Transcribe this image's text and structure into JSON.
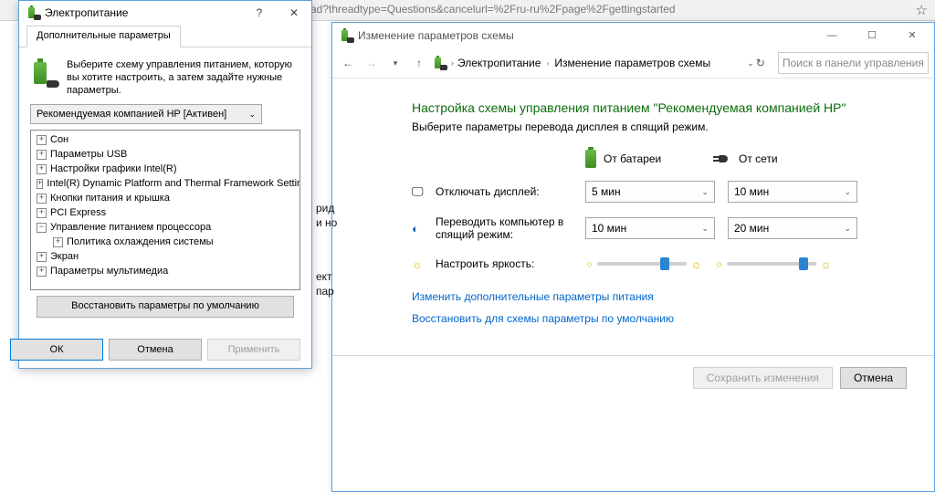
{
  "browser": {
    "url_fragment": "ad?threadtype=Questions&cancelurl=%2Fru-ru%2Fpage%2Fgettingstarted"
  },
  "peek": {
    "a": "рид",
    "b": "и но",
    "c": "ект",
    "d": "пар"
  },
  "plan_window": {
    "title": "Изменение параметров схемы",
    "crumb1": "Электропитание",
    "crumb2": "Изменение параметров схемы",
    "search_placeholder": "Поиск в панели управления",
    "heading": "Настройка схемы управления питанием \"Рекомендуемая компанией HP\"",
    "subheading": "Выберите параметры перевода дисплея в спящий режим.",
    "col_battery": "От батареи",
    "col_ac": "От сети",
    "row_display": "Отключать дисплей:",
    "row_sleep": "Переводить компьютер в спящий режим:",
    "row_brightness": "Настроить яркость:",
    "display_battery": "5 мин",
    "display_ac": "10 мин",
    "sleep_battery": "10 мин",
    "sleep_ac": "20 мин",
    "link_advanced": "Изменить дополнительные параметры питания",
    "link_restore": "Восстановить для схемы параметры по умолчанию",
    "btn_save": "Сохранить изменения",
    "btn_cancel": "Отмена"
  },
  "adv_window": {
    "title": "Электропитание",
    "tab": "Дополнительные параметры",
    "description": "Выберите схему управления питанием, которую вы хотите настроить, а затем задайте нужные параметры.",
    "plan_dd": "Рекомендуемая компанией HP [Активен]",
    "nodes": {
      "n1": "Сон",
      "n2": "Параметры USB",
      "n3": "Настройки графики Intel(R)",
      "n4": "Intel(R) Dynamic Platform and Thermal Framework Settings",
      "n5": "Кнопки питания и крышка",
      "n6": "PCI Express",
      "n7": "Управление питанием процессора",
      "n7a": "Политика охлаждения системы",
      "n8": "Экран",
      "n9": "Параметры мультимедиа"
    },
    "restore": "Восстановить параметры по умолчанию",
    "ok": "ОК",
    "cancel": "Отмена",
    "apply": "Применить"
  }
}
